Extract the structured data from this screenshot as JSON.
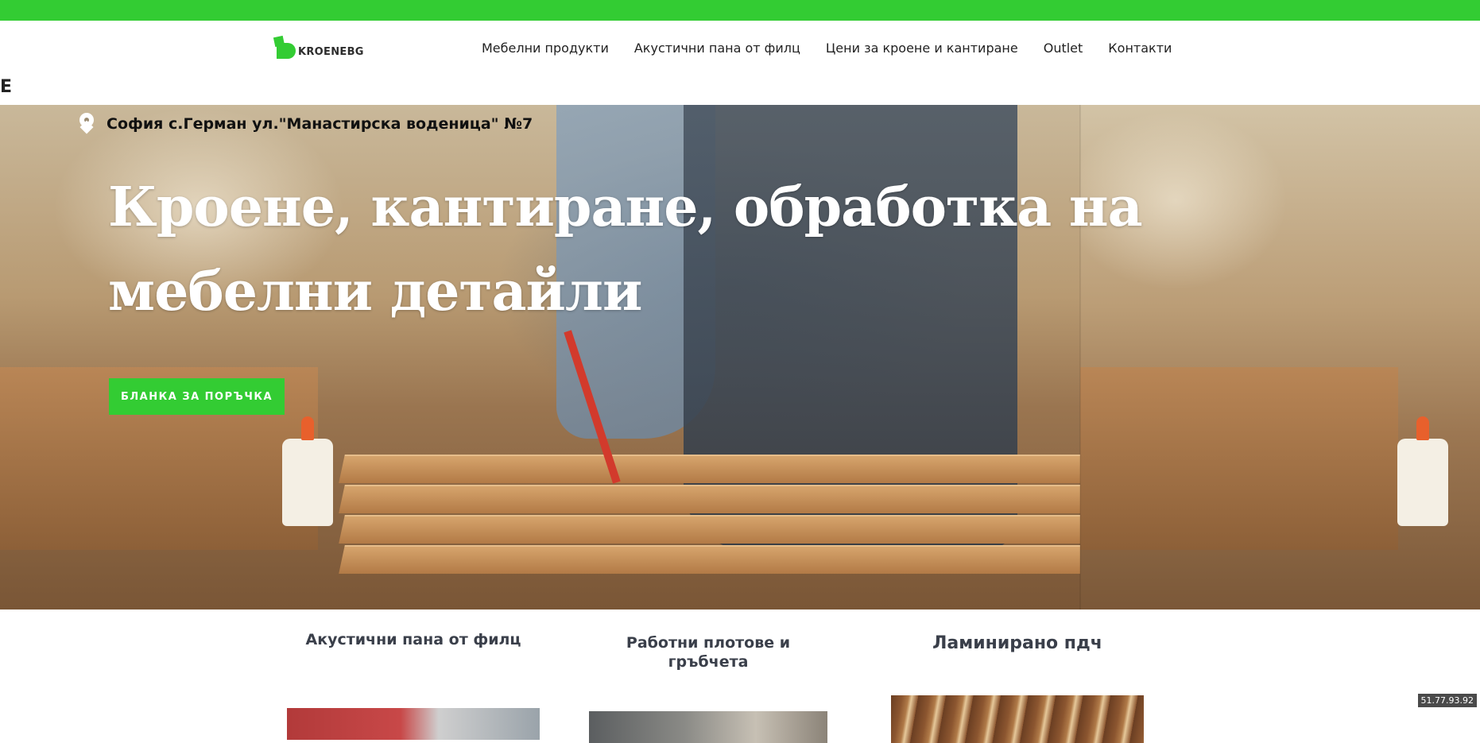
{
  "brand": {
    "logo_text": "KROENEBG",
    "accent_color": "#33cc33"
  },
  "nav": {
    "items": [
      {
        "label": "Мебелни продукти"
      },
      {
        "label": "Акустични пана от филц"
      },
      {
        "label": "Цени за кроене и кантиране"
      },
      {
        "label": "Outlet"
      },
      {
        "label": "Контакти"
      }
    ]
  },
  "edge_letter": "E",
  "hero": {
    "address_icon": "map-pin-icon",
    "address": "София с.Герман ул.\"Манастирска воденица\" №7",
    "title": "Кроене, кантиране, обработка на мебелни детайли",
    "cta_label": "БЛАНКА ЗА ПОРЪЧКА"
  },
  "cards": [
    {
      "title": "Акустични пана от филц"
    },
    {
      "title": "Работни плотове и гръбчета"
    },
    {
      "title": "Ламинирано пдч"
    }
  ],
  "ip_badge": "51.77.93.92"
}
